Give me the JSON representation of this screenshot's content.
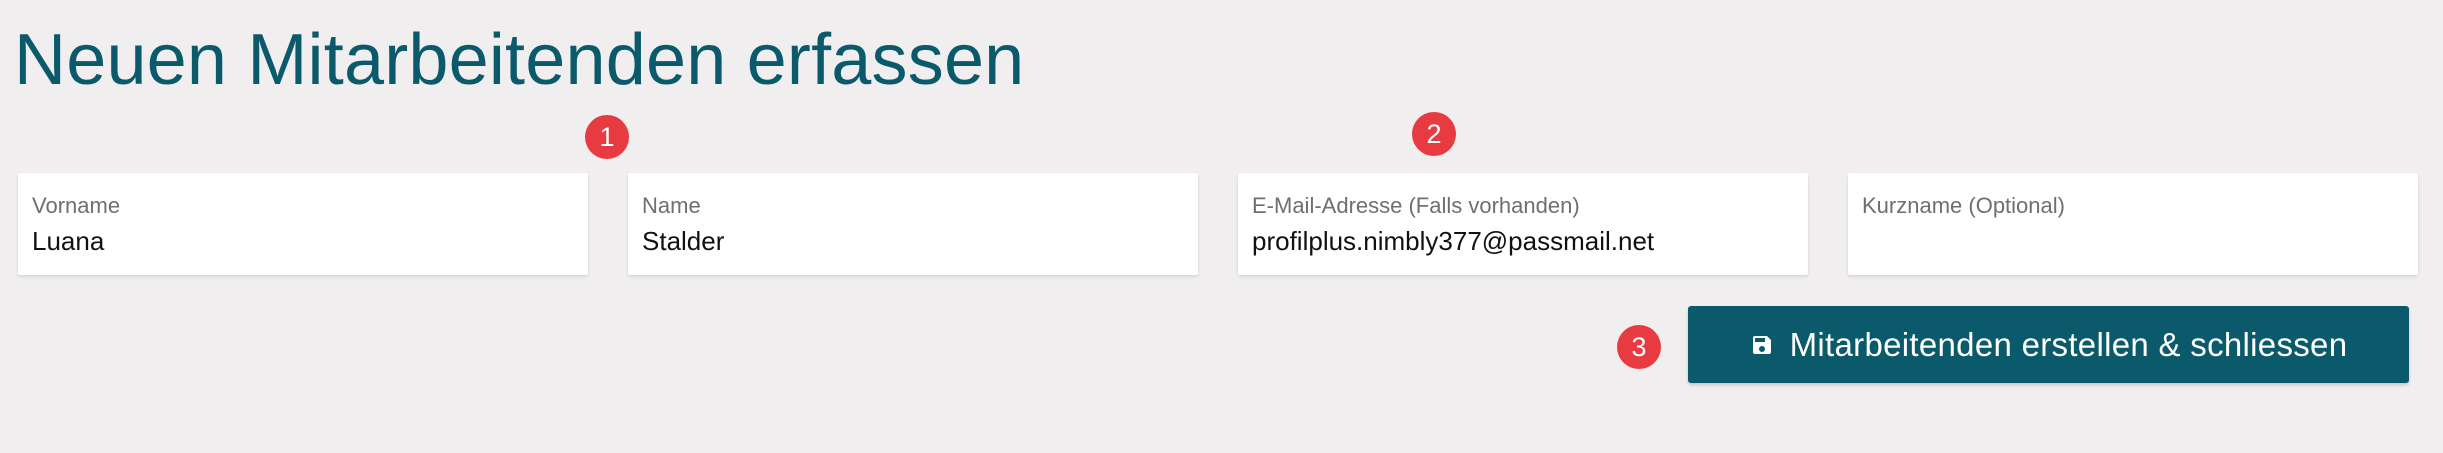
{
  "page": {
    "title": "Neuen Mitarbeitenden erfassen"
  },
  "form": {
    "fields": [
      {
        "label": "Vorname",
        "value": "Luana",
        "placeholder": ""
      },
      {
        "label": "Name",
        "value": "Stalder",
        "placeholder": ""
      },
      {
        "label": "E-Mail-Adresse (Falls vorhanden)",
        "value": "profilplus.nimbly377@passmail.net",
        "placeholder": ""
      },
      {
        "label": "Kurzname (Optional)",
        "value": "",
        "placeholder": ""
      }
    ],
    "submit": {
      "label": "Mitarbeitenden erstellen & schliessen",
      "icon": "save-icon"
    }
  },
  "badges": [
    "1",
    "2",
    "3"
  ],
  "colors": {
    "background": "#f1eeef",
    "accent": "#0b5a6b",
    "badge": "#e83a41",
    "field_background": "#ffffff"
  }
}
